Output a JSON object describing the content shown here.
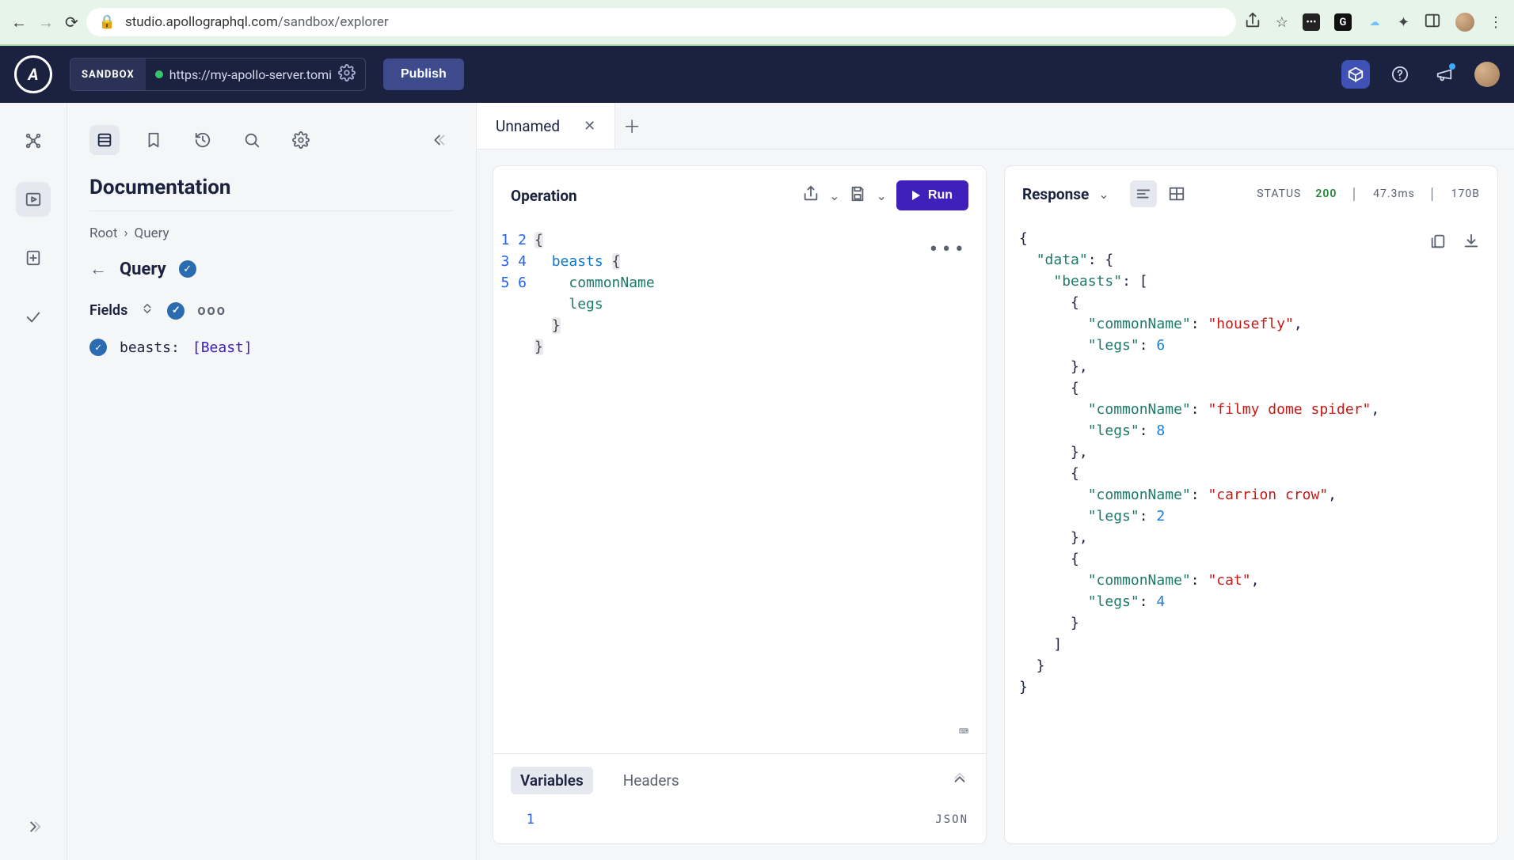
{
  "browser": {
    "url_host": "studio.apollographql.com",
    "url_path": "/sandbox/explorer"
  },
  "topbar": {
    "sandbox_label": "SANDBOX",
    "server_url": "https://my-apollo-server.tomi",
    "publish_label": "Publish"
  },
  "doc": {
    "title": "Documentation",
    "breadcrumb_root": "Root",
    "breadcrumb_query": "Query",
    "query_heading": "Query",
    "fields_heading": "Fields",
    "field_name": "beasts:",
    "field_type": "[Beast]"
  },
  "tabs": {
    "active_name": "Unnamed"
  },
  "operation": {
    "heading": "Operation",
    "run_label": "Run",
    "lines": [
      "{",
      "  beasts {",
      "    commonName",
      "    legs",
      "  }",
      "}"
    ],
    "line_count": 6
  },
  "variables": {
    "tab_variables": "Variables",
    "tab_headers": "Headers",
    "line1": "1",
    "json_label": "JSON"
  },
  "response": {
    "heading": "Response",
    "status_label": "STATUS",
    "status_code": "200",
    "timing": "47.3ms",
    "size": "170B",
    "data": {
      "data": {
        "beasts": [
          {
            "commonName": "housefly",
            "legs": 6
          },
          {
            "commonName": "filmy dome spider",
            "legs": 8
          },
          {
            "commonName": "carrion crow",
            "legs": 2
          },
          {
            "commonName": "cat",
            "legs": 4
          }
        ]
      }
    }
  }
}
